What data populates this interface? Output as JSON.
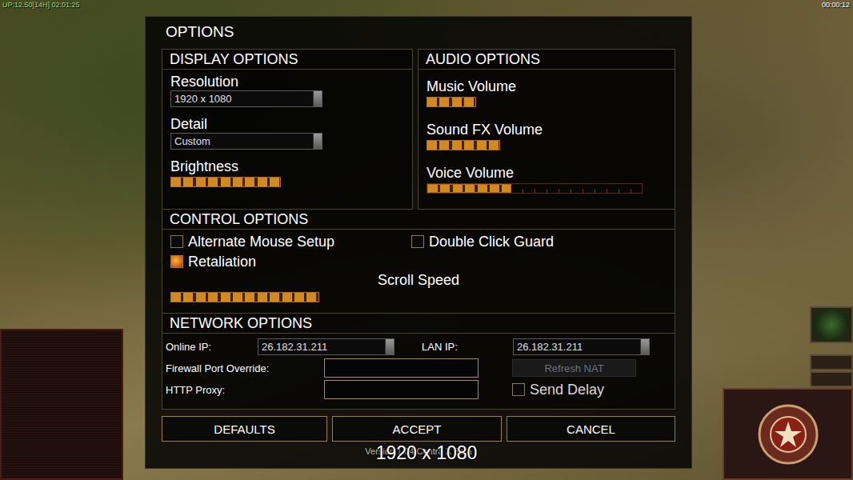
{
  "hud": {
    "top_left": "UP:12.50[14H] 02:01:25",
    "top_right": "00:00:12"
  },
  "dialog": {
    "title": "OPTIONS"
  },
  "display": {
    "heading": "DISPLAY OPTIONS",
    "resolution": {
      "label": "Resolution",
      "value": "1920 x 1080"
    },
    "detail": {
      "label": "Detail",
      "value": "Custom"
    },
    "brightness": {
      "label": "Brightness",
      "level": 0.51,
      "track_shown": false
    }
  },
  "audio": {
    "heading": "AUDIO OPTIONS",
    "sliders": [
      {
        "label": "Music Volume",
        "level": 0.23,
        "track_shown": false
      },
      {
        "label": "Sound FX Volume",
        "level": 0.34,
        "track_shown": false
      },
      {
        "label": "Voice Volume",
        "level": 0.39,
        "track_shown": true
      }
    ]
  },
  "controls": {
    "heading": "CONTROL OPTIONS",
    "checkboxes": [
      {
        "label": "Alternate Mouse Setup",
        "checked": false
      },
      {
        "label": "Double Click Guard",
        "checked": false
      },
      {
        "label": "Retaliation",
        "checked": true
      }
    ],
    "scroll_speed": {
      "label": "Scroll Speed",
      "level": 0.69,
      "track_shown": false
    }
  },
  "network": {
    "heading": "NETWORK OPTIONS",
    "online_ip": {
      "label": "Online IP:",
      "value": "26.182.31.211"
    },
    "lan_ip": {
      "label": "LAN IP:",
      "value": "26.182.31.211"
    },
    "firewall": {
      "label": "Firewall Port Override:",
      "value": ""
    },
    "proxy": {
      "label": "HTTP Proxy:",
      "value": ""
    },
    "refresh_nat": {
      "label": "Refresh NAT",
      "disabled": true
    },
    "send_delay": {
      "label": "Send Delay",
      "checked": false
    }
  },
  "buttons": [
    "DEFAULTS",
    "ACCEPT",
    "CANCEL"
  ],
  "version": "Version 1.04 Contra X Beta",
  "overlay": "1920 x 1080"
}
